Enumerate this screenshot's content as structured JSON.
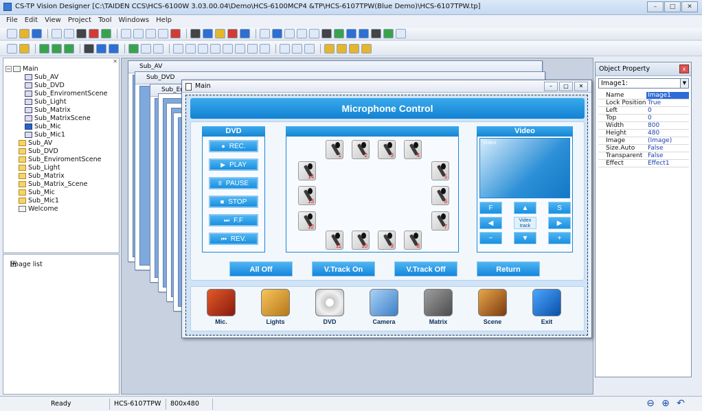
{
  "window": {
    "title": "CS-TP Vision Designer [C:\\TAIDEN CCS\\HCS-6100W 3.03.00.04\\Demo\\HCS-6100MCP4 &TP\\HCS-6107TPW(Blue Demo)\\HCS-6107TPW.tp]",
    "buttons": [
      "–",
      "□",
      "✕"
    ]
  },
  "menu": [
    "File",
    "Edit",
    "View",
    "Project",
    "Tool",
    "Windows",
    "Help"
  ],
  "tree": {
    "root": "Main",
    "children": [
      "Sub_AV",
      "Sub_DVD",
      "Sub_EnviromentScene",
      "Sub_Light",
      "Sub_Matrix",
      "Sub_MatrixScene",
      "Sub_Mic",
      "Sub_Mic1"
    ],
    "top_items": [
      "Sub_AV",
      "Sub_DVD",
      "Sub_EnviromentScene",
      "Sub_Light",
      "Sub_Matrix",
      "Sub_Matrix_Scene",
      "Sub_Mic",
      "Sub_Mic1",
      "Welcome"
    ],
    "image_list": "Image list",
    "fold_minus": "−",
    "fold_plus": "+"
  },
  "bg_windows": [
    "Sub_AV",
    "Sub_DVD",
    "Sub_En"
  ],
  "main_window": {
    "title": "Main",
    "buttons": [
      "–",
      "□",
      "✕"
    ]
  },
  "design": {
    "header": "Microphone Control",
    "dvd_title": "DVD",
    "dvd_buttons": [
      {
        "icon": "●",
        "label": "REC."
      },
      {
        "icon": "▶",
        "label": "PLAY"
      },
      {
        "icon": "II",
        "label": "PAUSE"
      },
      {
        "icon": "■",
        "label": "STOP"
      },
      {
        "icon": "⏭",
        "label": "F.F"
      },
      {
        "icon": "⏮",
        "label": "REV."
      }
    ],
    "mic_numbers": [
      "1",
      "2",
      "3",
      "4",
      "5",
      "6",
      "7",
      "8",
      "9",
      "10",
      "11",
      "12",
      "13",
      "14"
    ],
    "video_title": "Video",
    "video_screen_label": "Video",
    "video_buttons": [
      "F",
      "▲",
      "S",
      "◀",
      "Video track",
      "▶",
      "−",
      "▼",
      "+"
    ],
    "actions": [
      "All Off",
      "V.Track On",
      "V.Track Off",
      "Return"
    ],
    "nav": [
      "Mic.",
      "Lights",
      "DVD",
      "Camera",
      "Matrix",
      "Scene",
      "Exit"
    ]
  },
  "properties": {
    "title": "Object Property",
    "close": "x",
    "selected": "Image1:",
    "dropdown": "▼",
    "rows": [
      {
        "name": "Name",
        "value": "Image1"
      },
      {
        "name": "Lock Position",
        "value": "True"
      },
      {
        "name": "Left",
        "value": "0"
      },
      {
        "name": "Top",
        "value": "0"
      },
      {
        "name": "Width",
        "value": "800"
      },
      {
        "name": "Height",
        "value": "480"
      },
      {
        "name": "Image",
        "value": "(Image)"
      },
      {
        "name": "Size.Auto",
        "value": "False"
      },
      {
        "name": "Transparent",
        "value": "False"
      },
      {
        "name": "Effect",
        "value": "Effect1"
      }
    ]
  },
  "status": {
    "state": "Ready",
    "device": "HCS-6107TPW",
    "resolution": "800x480",
    "zoom_out": "⊖",
    "zoom_in": "⊕",
    "undo": "↶"
  }
}
